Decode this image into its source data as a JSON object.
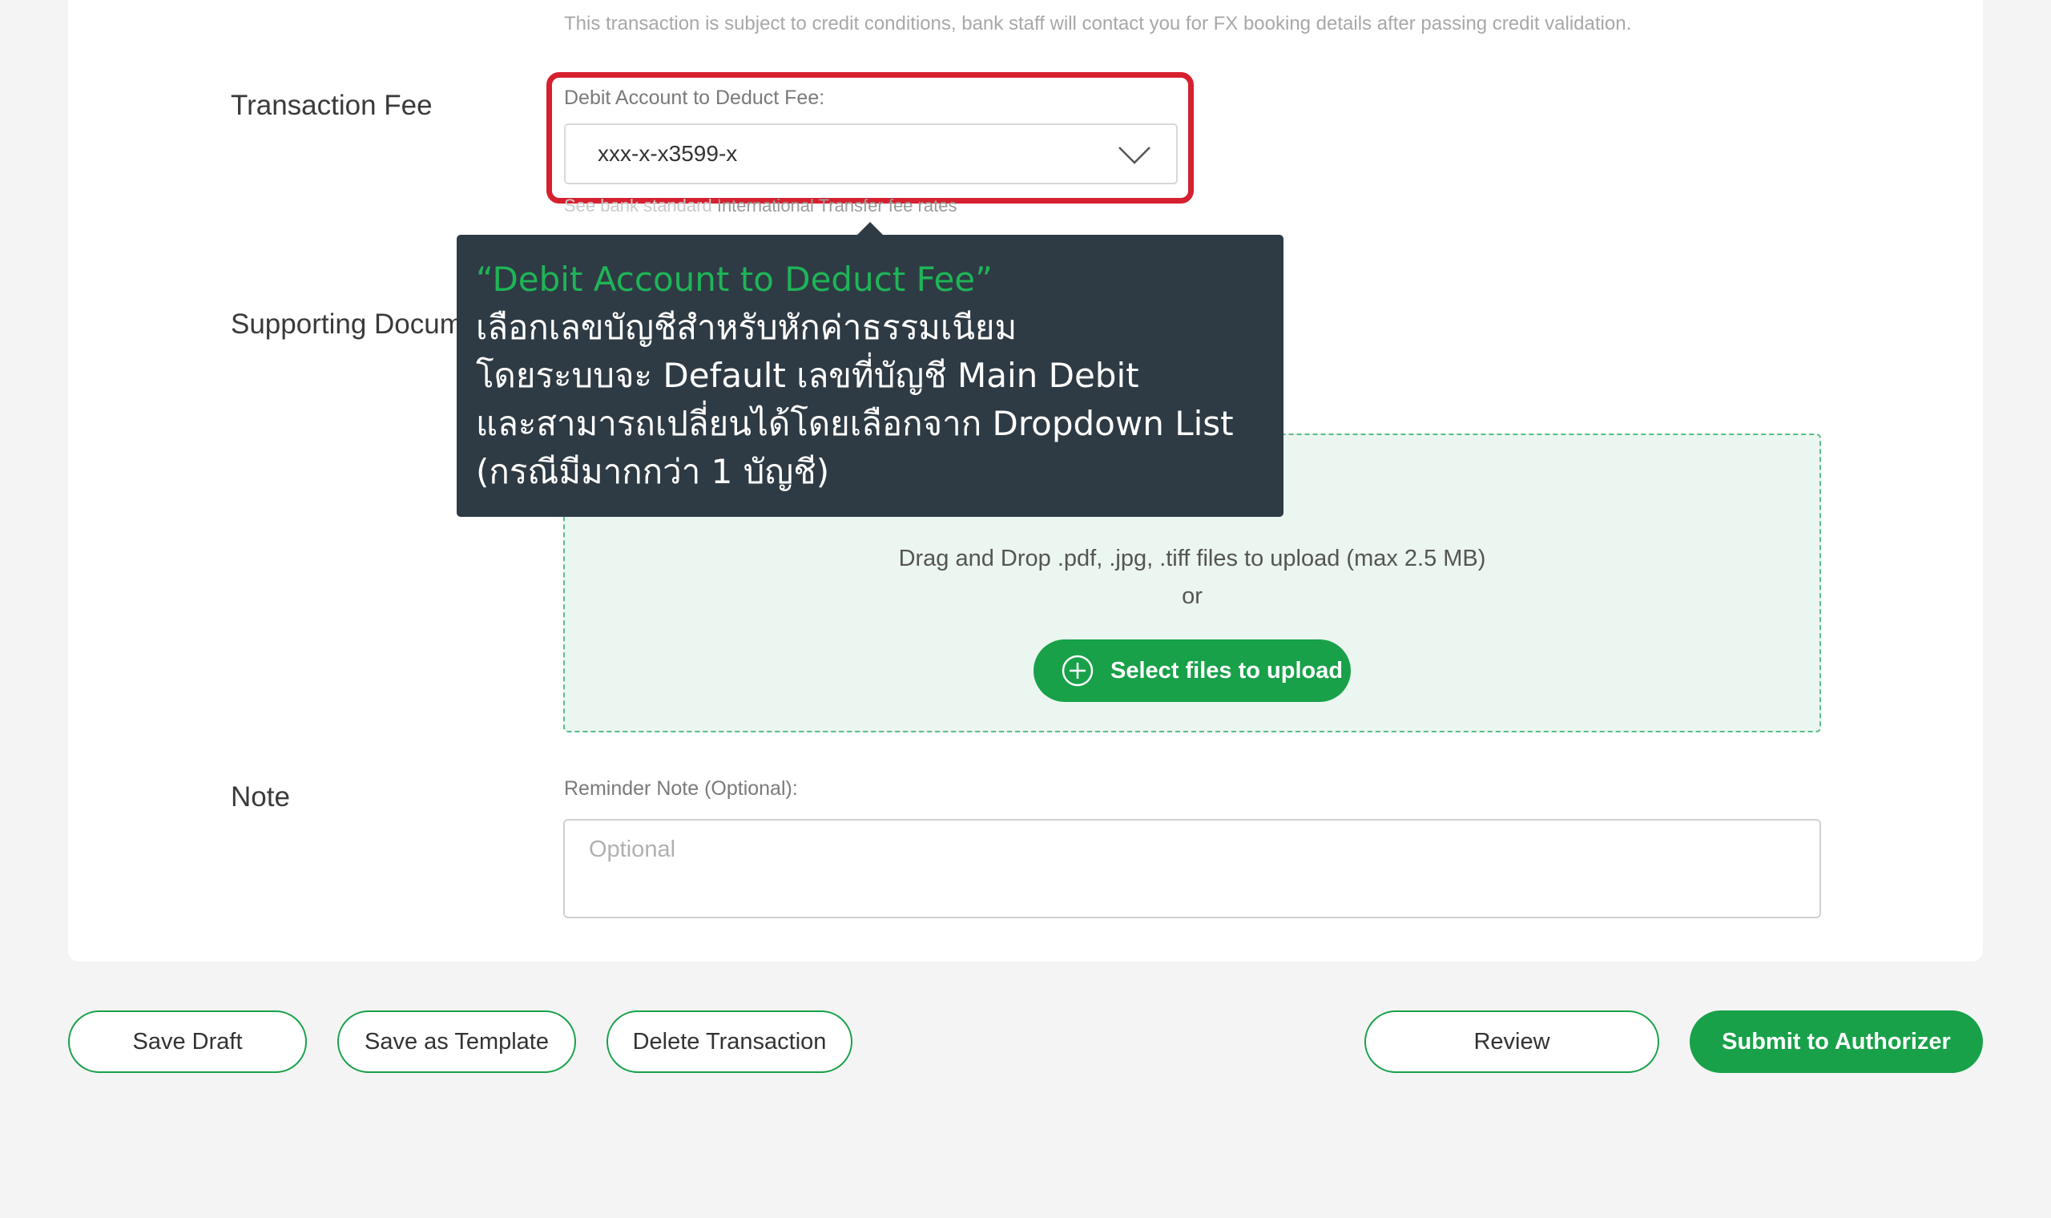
{
  "notice": "This transaction is subject to credit conditions, bank staff will contact you for FX booking details after passing credit validation.",
  "transaction_fee": {
    "section_label": "Transaction Fee",
    "field_label": "Debit Account to Deduct Fee:",
    "selected_value": "xxx-x-x3599-x",
    "fee_note_prefix": "See bank standard",
    "fee_note_link": "International Transfer fee rates"
  },
  "supporting_documents": {
    "section_label": "Supporting Docum",
    "drop_text": "Drag and Drop .pdf, .jpg, .tiff files to upload (max 2.5 MB)",
    "or_text": "or",
    "upload_button": "Select files to upload"
  },
  "note": {
    "section_label": "Note",
    "field_label": "Reminder Note (Optional):",
    "placeholder": "Optional"
  },
  "tooltip": {
    "title": "“Debit Account to Deduct Fee”",
    "lines": [
      "เลือกเลขบัญชีสำหรับหักค่าธรรมเนียม",
      "โดยระบบจะ Default เลขที่บัญชี Main Debit",
      "และสามารถเปลี่ยนได้โดยเลือกจาก Dropdown List",
      "(กรณีมีมากกว่า 1 บัญชี)"
    ]
  },
  "footer": {
    "save_draft": "Save Draft",
    "save_template": "Save as Template",
    "delete_transaction": "Delete Transaction",
    "review": "Review",
    "submit": "Submit to Authorizer"
  },
  "colors": {
    "accent": "#18a149",
    "highlight": "#d6202f",
    "tooltip_bg": "#2e3b44",
    "dropzone_bg": "#eaf6ef"
  },
  "icons": {
    "chevron": "chevron-down-icon",
    "upload": "plus-circle-icon"
  }
}
